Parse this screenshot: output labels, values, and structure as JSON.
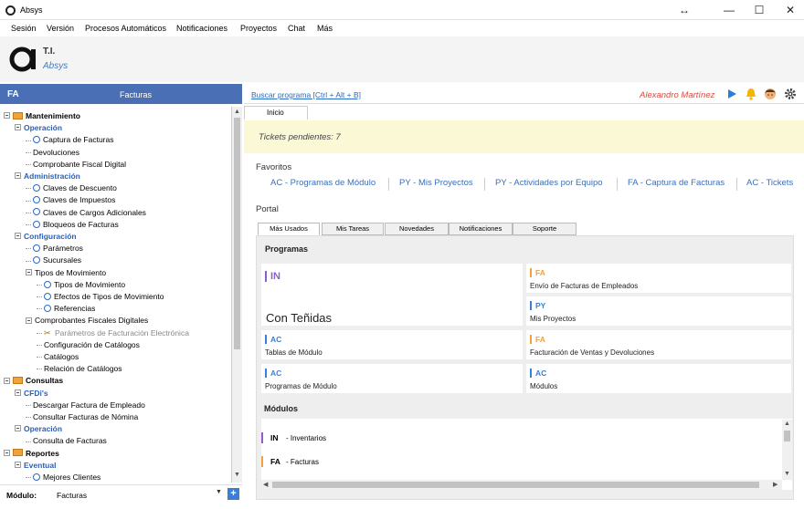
{
  "window": {
    "title": "Absys",
    "controls": [
      "↔",
      "—",
      "☐",
      "✕"
    ]
  },
  "menu": [
    "Sesión",
    "Versión",
    "Procesos Automáticos",
    "Notificaciones",
    "Proyectos",
    "Chat",
    "Más"
  ],
  "brand": {
    "line1": "T.I.",
    "line2": "Absys"
  },
  "left_header": {
    "code": "FA",
    "name": "Facturas"
  },
  "tree": [
    {
      "type": "cat",
      "label": "Mantenimiento"
    },
    {
      "type": "sub",
      "label": "Operación"
    },
    {
      "type": "item",
      "label": "Captura de Facturas"
    },
    {
      "type": "plain",
      "label": "Devoluciones"
    },
    {
      "type": "plain",
      "label": "Comprobante Fiscal Digital"
    },
    {
      "type": "sub",
      "label": "Administración"
    },
    {
      "type": "item",
      "label": "Claves de Descuento"
    },
    {
      "type": "item",
      "label": "Claves de Impuestos"
    },
    {
      "type": "item",
      "label": "Claves de Cargos Adicionales"
    },
    {
      "type": "item",
      "label": "Bloqueos de Facturas"
    },
    {
      "type": "sub",
      "label": "Configuración"
    },
    {
      "type": "item",
      "label": "Parámetros"
    },
    {
      "type": "item",
      "label": "Sucursales"
    },
    {
      "type": "group",
      "label": "Tipos de Movimiento"
    },
    {
      "type": "item2",
      "label": "Tipos de Movimiento"
    },
    {
      "type": "item2",
      "label": "Efectos de Tipos de Movimiento"
    },
    {
      "type": "item2",
      "label": "Referencias"
    },
    {
      "type": "group",
      "label": "Comprobantes Fiscales Digitales"
    },
    {
      "type": "tool",
      "label": "Parámetros de Facturación Electrónica"
    },
    {
      "type": "plain2",
      "label": "Configuración de Catálogos"
    },
    {
      "type": "plain2",
      "label": "Catálogos"
    },
    {
      "type": "plain2",
      "label": "Relación de Catálogos"
    },
    {
      "type": "cat",
      "label": "Consultas"
    },
    {
      "type": "sub",
      "label": "CFDi's"
    },
    {
      "type": "plain",
      "label": "Descargar Factura de Empleado"
    },
    {
      "type": "plain",
      "label": "Consultar Facturas de Nómina"
    },
    {
      "type": "sub",
      "label": "Operación"
    },
    {
      "type": "plain",
      "label": "Consulta de Facturas"
    },
    {
      "type": "cat",
      "label": "Reportes"
    },
    {
      "type": "sub",
      "label": "Eventual"
    },
    {
      "type": "item",
      "label": "Mejores Clientes"
    }
  ],
  "module_bar": {
    "label": "Módulo:",
    "value": "Facturas"
  },
  "top": {
    "search": "Buscar programa [Ctrl + Alt + B]",
    "user": "Alexandro Martínez"
  },
  "home_tab": "Inicio",
  "tickets": "Tickets pendientes: 7",
  "favorites": {
    "title": "Favoritos",
    "items": [
      "AC - Programas de Módulo",
      "PY - Mis Proyectos",
      "PY - Actividades por Equipo",
      "FA - Captura de Facturas",
      "AC - Tickets"
    ]
  },
  "portal": {
    "title": "Portal",
    "tabs": [
      "Más Usados",
      "Mis Tareas",
      "Novedades",
      "Notificaciones",
      "Soporte"
    ],
    "programs_title": "Programas",
    "cards": [
      {
        "code": "IN",
        "desc": "",
        "color": "#8a5fc7"
      },
      {
        "code": "FA",
        "desc": "Envío de Facturas de Empleados",
        "color": "#f0a23c"
      },
      {
        "code": "",
        "desc": "Con Teñidas",
        "color": ""
      },
      {
        "code": "PY",
        "desc": "Mis Proyectos",
        "color": "#3a7fd5"
      },
      {
        "code": "AC",
        "desc": "Tablas de Módulo",
        "color": "#3a7fd5"
      },
      {
        "code": "FA",
        "desc": "Facturación de Ventas y Devoluciones",
        "color": "#f0a23c"
      },
      {
        "code": "AC",
        "desc": "Programas de Módulo",
        "color": "#3a7fd5"
      },
      {
        "code": "AC",
        "desc": "Módulos",
        "color": "#3a7fd5"
      }
    ],
    "modules_title": "Módulos",
    "modules": [
      {
        "code": "IN",
        "desc": "- Inventarios",
        "color": "#8a5fc7"
      },
      {
        "code": "FA",
        "desc": "- Facturas",
        "color": "#f0a23c"
      }
    ]
  }
}
